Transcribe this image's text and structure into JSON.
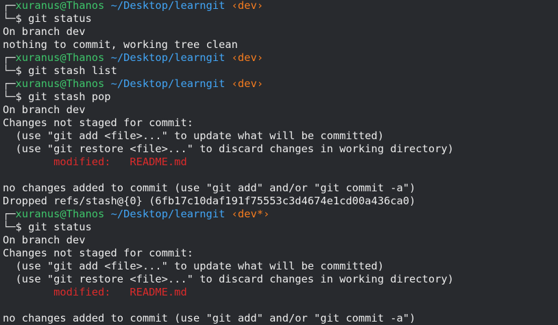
{
  "colors": {
    "background": "#282a2e",
    "text": "#ececec",
    "user": "#3ec46a",
    "path": "#42a5f5",
    "branch": "#f57c1f",
    "modified": "#dc2b2b"
  },
  "prompt": {
    "top_bracket": "┌─",
    "bottom_bracket": "└─",
    "user_host": "xuranus@Thanos",
    "path": "~/Desktop/learngit",
    "symbol": "$"
  },
  "blocks": [
    {
      "branch": "‹dev›",
      "command": "git status",
      "output": [
        {
          "text": "On branch dev"
        },
        {
          "text": "nothing to commit, working tree clean"
        }
      ]
    },
    {
      "branch": "‹dev›",
      "command": "git stash list",
      "output": []
    },
    {
      "branch": "‹dev›",
      "command": "git stash pop",
      "output": [
        {
          "text": "On branch dev"
        },
        {
          "text": "Changes not staged for commit:"
        },
        {
          "text": "  (use \"git add <file>...\" to update what will be committed)"
        },
        {
          "text": "  (use \"git restore <file>...\" to discard changes in working directory)"
        },
        {
          "text": "        modified:   README.md",
          "type": "modified"
        },
        {
          "text": ""
        },
        {
          "text": "no changes added to commit (use \"git add\" and/or \"git commit -a\")"
        },
        {
          "text": "Dropped refs/stash@{0} (6fb17c10daf191f75553c3d4674e1cd00a436ca0)"
        }
      ]
    },
    {
      "branch": "‹dev*›",
      "command": "git status",
      "output": [
        {
          "text": "On branch dev"
        },
        {
          "text": "Changes not staged for commit:"
        },
        {
          "text": "  (use \"git add <file>...\" to update what will be committed)"
        },
        {
          "text": "  (use \"git restore <file>...\" to discard changes in working directory)"
        },
        {
          "text": "        modified:   README.md",
          "type": "modified"
        },
        {
          "text": ""
        },
        {
          "text": "no changes added to commit (use \"git add\" and/or \"git commit -a\")"
        }
      ]
    }
  ]
}
